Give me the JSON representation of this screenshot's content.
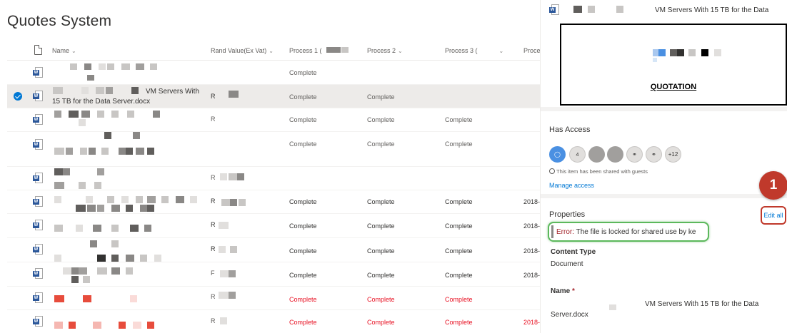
{
  "title": "Quotes System",
  "columns": {
    "name": "Name",
    "rand": "Rand Value(Ex Vat)",
    "p1": "Process 1 (",
    "p2": "Process 2",
    "p3": "Process 3 (",
    "p4": "Proce"
  },
  "rows": [
    {
      "p1": "Complete",
      "p2": "",
      "p3": "",
      "date": "",
      "rand": ""
    },
    {
      "name_line1": "VM Servers With",
      "name_line2": "15 TB for the Data Server.docx",
      "rand": "R",
      "p1": "Complete",
      "p2": "Complete",
      "p3": "",
      "date": ""
    },
    {
      "rand": "R",
      "p1": "Complete",
      "p2": "Complete",
      "p3": "Complete",
      "date": ""
    },
    {
      "rand": "",
      "p1": "Complete",
      "p2": "Complete",
      "p3": "Complete",
      "date": ""
    },
    {
      "rand": "R",
      "p1": "",
      "p2": "",
      "p3": "",
      "date": ""
    },
    {
      "rand": "R",
      "p1": "Complete",
      "p2": "Complete",
      "p3": "Complete",
      "date": "2018-"
    },
    {
      "rand": "R",
      "p1": "Complete",
      "p2": "Complete",
      "p3": "Complete",
      "date": "2018-"
    },
    {
      "rand": "R",
      "p1": "Complete",
      "p2": "Complete",
      "p3": "Complete",
      "date": "2018-"
    },
    {
      "rand": "F",
      "p1": "Complete",
      "p2": "Complete",
      "p3": "Complete",
      "date": "2018-"
    },
    {
      "rand": "R",
      "p1": "Complete",
      "p2": "Complete",
      "p3": "Complete",
      "date": "",
      "error": true
    },
    {
      "rand": "R",
      "p1": "Complete",
      "p2": "Complete",
      "p3": "Complete",
      "date": "2018-",
      "error": true
    }
  ],
  "panel": {
    "file_title": "VM Servers With 15 TB for the Data",
    "preview_heading": "QUOTATION",
    "has_access": "Has Access",
    "avatar_count_label": "4",
    "avatar_more": "+12",
    "shared_note": "This item has been shared with guests",
    "manage_access": "Manage access",
    "properties": "Properties",
    "edit_all": "Edit all",
    "badge_number": "1",
    "error_prefix": "Error:",
    "error_message": " The file is locked for shared use by ke",
    "content_type_label": "Content Type",
    "content_type_value": "Document",
    "name_label": "Name",
    "name_required": "*",
    "name_value_line1": "VM Servers With 15 TB for the Data",
    "name_value_line2": "Server.docx"
  },
  "colors": {
    "accent": "#0078d4",
    "error": "#e81123",
    "badge": "#c0392b",
    "highlight": "#5cb85c"
  }
}
